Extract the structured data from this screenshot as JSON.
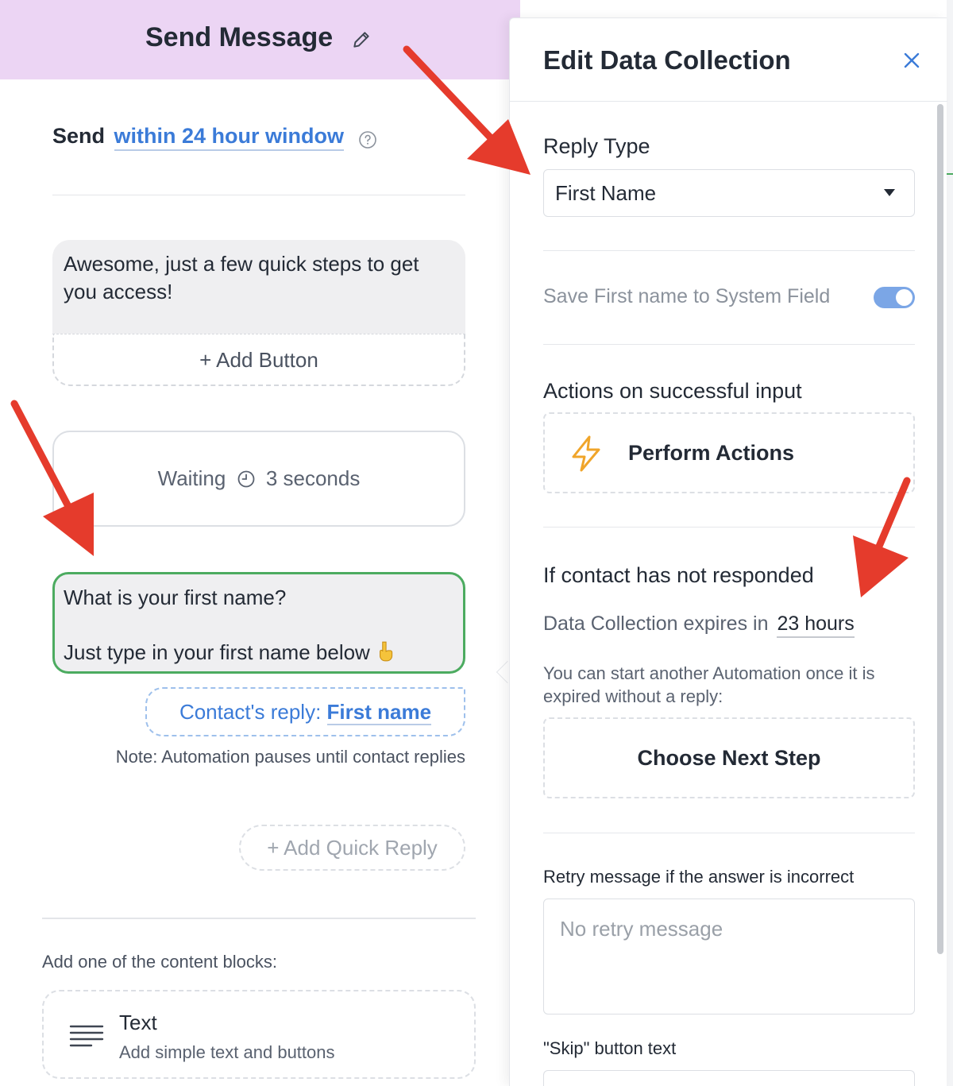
{
  "editor": {
    "title": "Send Message",
    "send_label": "Send",
    "send_window_link": "within 24 hour window",
    "message_text": "Awesome, just a few quick steps to get you access!",
    "add_button_label": "+ Add Button",
    "waiting_label": "Waiting",
    "waiting_value": "3 seconds",
    "question_line_1": "What is your first name?",
    "question_line_2": "Just type in your first name below",
    "contact_reply_prefix": "Contact's reply:",
    "contact_reply_value": "First name",
    "note": "Note: Automation pauses until contact replies",
    "add_quick_reply_label": "+ Add Quick Reply",
    "content_blocks_label": "Add one of the content blocks:",
    "text_block": {
      "title": "Text",
      "description": "Add simple text and buttons"
    }
  },
  "panel": {
    "title": "Edit Data Collection",
    "reply_type_label": "Reply Type",
    "reply_type_value": "First Name",
    "save_system_field_label": "Save First name to System Field",
    "save_system_field_on": true,
    "actions_label": "Actions on successful input",
    "perform_actions_label": "Perform Actions",
    "not_responded_label": "If contact has not responded",
    "expires_label": "Data Collection expires in",
    "expires_value": "23 hours",
    "start_another_text": "You can start another Automation once it is expired without a reply:",
    "choose_next_step_label": "Choose Next Step",
    "retry_label": "Retry message if the answer is incorrect",
    "retry_placeholder": "No retry message",
    "skip_label": "\"Skip\" button text"
  },
  "colors": {
    "header_bg": "#ecd5f4",
    "link": "#3b7bd8",
    "active_border": "#4cab60",
    "toggle": "#7ba6e6",
    "bolt": "#f0a52a",
    "annotation_arrow": "#e53b2c"
  },
  "icons": {
    "edit": "pencil-icon",
    "help": "help-circle-icon",
    "clock": "clock-icon",
    "hand": "point-down-icon",
    "close": "close-icon",
    "dropdown": "caret-down-icon",
    "actions": "bolt-icon",
    "text_block": "lines-icon"
  }
}
